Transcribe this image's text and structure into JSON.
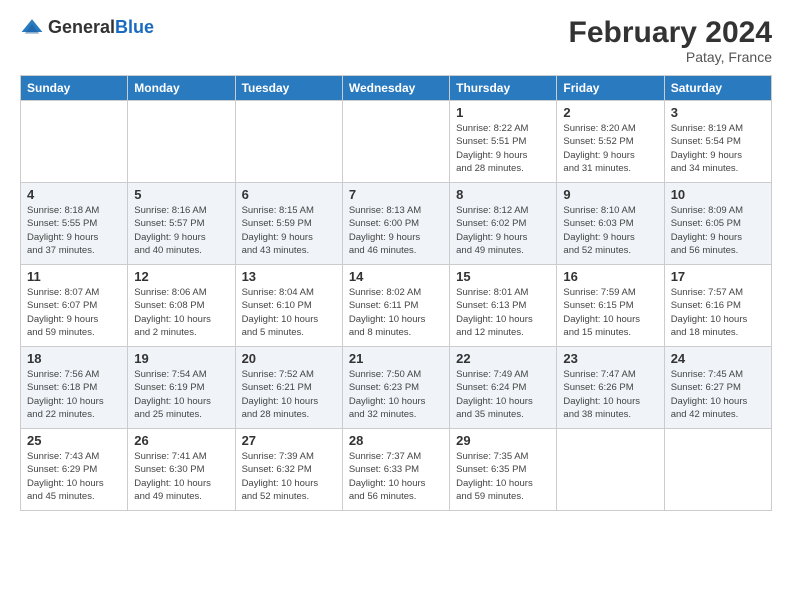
{
  "header": {
    "logo_general": "General",
    "logo_blue": "Blue",
    "month_title": "February 2024",
    "location": "Patay, France"
  },
  "days_of_week": [
    "Sunday",
    "Monday",
    "Tuesday",
    "Wednesday",
    "Thursday",
    "Friday",
    "Saturday"
  ],
  "weeks": [
    [
      {
        "day": "",
        "info": ""
      },
      {
        "day": "",
        "info": ""
      },
      {
        "day": "",
        "info": ""
      },
      {
        "day": "",
        "info": ""
      },
      {
        "day": "1",
        "info": "Sunrise: 8:22 AM\nSunset: 5:51 PM\nDaylight: 9 hours\nand 28 minutes."
      },
      {
        "day": "2",
        "info": "Sunrise: 8:20 AM\nSunset: 5:52 PM\nDaylight: 9 hours\nand 31 minutes."
      },
      {
        "day": "3",
        "info": "Sunrise: 8:19 AM\nSunset: 5:54 PM\nDaylight: 9 hours\nand 34 minutes."
      }
    ],
    [
      {
        "day": "4",
        "info": "Sunrise: 8:18 AM\nSunset: 5:55 PM\nDaylight: 9 hours\nand 37 minutes."
      },
      {
        "day": "5",
        "info": "Sunrise: 8:16 AM\nSunset: 5:57 PM\nDaylight: 9 hours\nand 40 minutes."
      },
      {
        "day": "6",
        "info": "Sunrise: 8:15 AM\nSunset: 5:59 PM\nDaylight: 9 hours\nand 43 minutes."
      },
      {
        "day": "7",
        "info": "Sunrise: 8:13 AM\nSunset: 6:00 PM\nDaylight: 9 hours\nand 46 minutes."
      },
      {
        "day": "8",
        "info": "Sunrise: 8:12 AM\nSunset: 6:02 PM\nDaylight: 9 hours\nand 49 minutes."
      },
      {
        "day": "9",
        "info": "Sunrise: 8:10 AM\nSunset: 6:03 PM\nDaylight: 9 hours\nand 52 minutes."
      },
      {
        "day": "10",
        "info": "Sunrise: 8:09 AM\nSunset: 6:05 PM\nDaylight: 9 hours\nand 56 minutes."
      }
    ],
    [
      {
        "day": "11",
        "info": "Sunrise: 8:07 AM\nSunset: 6:07 PM\nDaylight: 9 hours\nand 59 minutes."
      },
      {
        "day": "12",
        "info": "Sunrise: 8:06 AM\nSunset: 6:08 PM\nDaylight: 10 hours\nand 2 minutes."
      },
      {
        "day": "13",
        "info": "Sunrise: 8:04 AM\nSunset: 6:10 PM\nDaylight: 10 hours\nand 5 minutes."
      },
      {
        "day": "14",
        "info": "Sunrise: 8:02 AM\nSunset: 6:11 PM\nDaylight: 10 hours\nand 8 minutes."
      },
      {
        "day": "15",
        "info": "Sunrise: 8:01 AM\nSunset: 6:13 PM\nDaylight: 10 hours\nand 12 minutes."
      },
      {
        "day": "16",
        "info": "Sunrise: 7:59 AM\nSunset: 6:15 PM\nDaylight: 10 hours\nand 15 minutes."
      },
      {
        "day": "17",
        "info": "Sunrise: 7:57 AM\nSunset: 6:16 PM\nDaylight: 10 hours\nand 18 minutes."
      }
    ],
    [
      {
        "day": "18",
        "info": "Sunrise: 7:56 AM\nSunset: 6:18 PM\nDaylight: 10 hours\nand 22 minutes."
      },
      {
        "day": "19",
        "info": "Sunrise: 7:54 AM\nSunset: 6:19 PM\nDaylight: 10 hours\nand 25 minutes."
      },
      {
        "day": "20",
        "info": "Sunrise: 7:52 AM\nSunset: 6:21 PM\nDaylight: 10 hours\nand 28 minutes."
      },
      {
        "day": "21",
        "info": "Sunrise: 7:50 AM\nSunset: 6:23 PM\nDaylight: 10 hours\nand 32 minutes."
      },
      {
        "day": "22",
        "info": "Sunrise: 7:49 AM\nSunset: 6:24 PM\nDaylight: 10 hours\nand 35 minutes."
      },
      {
        "day": "23",
        "info": "Sunrise: 7:47 AM\nSunset: 6:26 PM\nDaylight: 10 hours\nand 38 minutes."
      },
      {
        "day": "24",
        "info": "Sunrise: 7:45 AM\nSunset: 6:27 PM\nDaylight: 10 hours\nand 42 minutes."
      }
    ],
    [
      {
        "day": "25",
        "info": "Sunrise: 7:43 AM\nSunset: 6:29 PM\nDaylight: 10 hours\nand 45 minutes."
      },
      {
        "day": "26",
        "info": "Sunrise: 7:41 AM\nSunset: 6:30 PM\nDaylight: 10 hours\nand 49 minutes."
      },
      {
        "day": "27",
        "info": "Sunrise: 7:39 AM\nSunset: 6:32 PM\nDaylight: 10 hours\nand 52 minutes."
      },
      {
        "day": "28",
        "info": "Sunrise: 7:37 AM\nSunset: 6:33 PM\nDaylight: 10 hours\nand 56 minutes."
      },
      {
        "day": "29",
        "info": "Sunrise: 7:35 AM\nSunset: 6:35 PM\nDaylight: 10 hours\nand 59 minutes."
      },
      {
        "day": "",
        "info": ""
      },
      {
        "day": "",
        "info": ""
      }
    ]
  ]
}
